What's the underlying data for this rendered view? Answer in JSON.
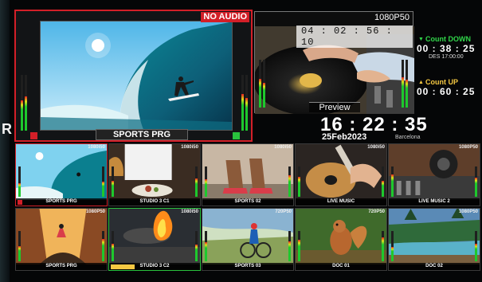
{
  "edge": {
    "glyph": "R"
  },
  "program": {
    "label": "SPORTS PRG",
    "warning": "NO AUDIO",
    "tally_left_color": "#d31f28",
    "tally_right_color": "#29c23d",
    "border_color": "#d31f28"
  },
  "preview": {
    "format": "1080P50",
    "timecode": "04 : 02 : 56 : 10",
    "label": "Preview"
  },
  "counters": {
    "down": {
      "title": "Count DOWN",
      "value": "00 : 38 : 25",
      "sub": "DES 17:00:00",
      "icon": "triangle-down-icon"
    },
    "up": {
      "title": "Count UP",
      "value": "00 : 60 : 25",
      "icon": "triangle-up-icon"
    }
  },
  "clock": {
    "time": "16 : 22 : 35",
    "date": "25Feb2023",
    "city": "Barcelona"
  },
  "tiles": [
    {
      "label": "SPORTS PRG",
      "res": "1080i50",
      "state": "program"
    },
    {
      "label": "STUDIO 3 C1",
      "res": "1080i50",
      "state": "normal"
    },
    {
      "label": "SPORTS 02",
      "res": "1080i50",
      "state": "normal"
    },
    {
      "label": "LIVE MUSIC",
      "res": "1080i50",
      "state": "normal"
    },
    {
      "label": "LIVE MUSIC 2",
      "res": "1080P50",
      "state": "normal"
    },
    {
      "label": "SPORTS PRG",
      "res": "1080P50",
      "state": "normal"
    },
    {
      "label": "STUDIO 3 C2",
      "res": "1080i50",
      "state": "preview"
    },
    {
      "label": "SPORTS 03",
      "res": "720P50",
      "state": "normal"
    },
    {
      "label": "DOC 01",
      "res": "720P50",
      "state": "normal"
    },
    {
      "label": "DOC 02",
      "res": "1080P50",
      "state": "normal"
    }
  ],
  "colors": {
    "program_red": "#d31f28",
    "preview_green": "#29c23d",
    "count_down": "#31d64a",
    "count_up": "#f5c842"
  }
}
